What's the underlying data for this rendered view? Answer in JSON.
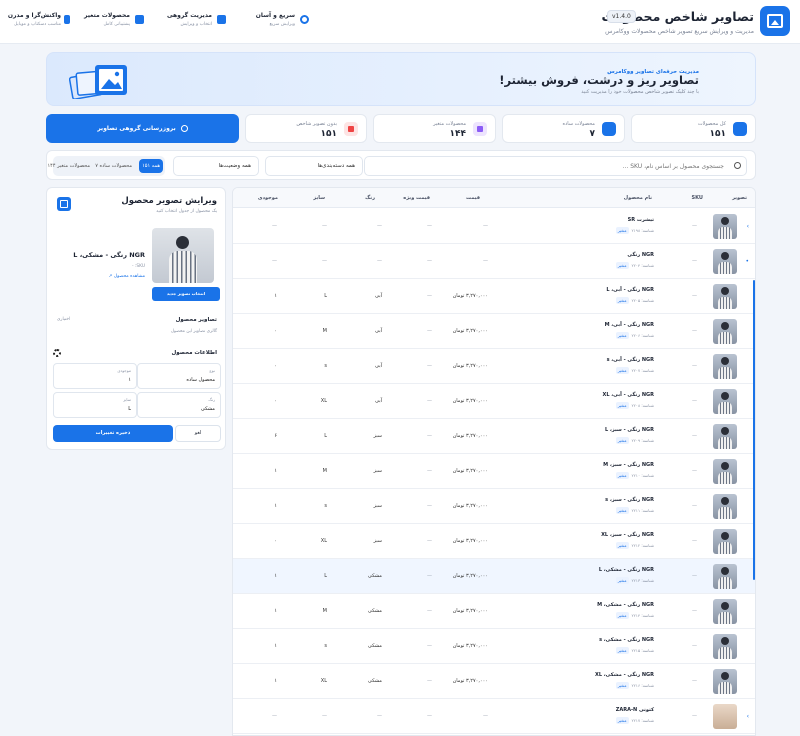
{
  "header": {
    "title": "تصاویر شاخص محصولات",
    "version": "v1.4.0",
    "subtitle": "مدیریت و ویرایش سریع تصویر شاخص محصولات ووکامرس",
    "nav": [
      {
        "title": "سریع و آسان",
        "sub": "ویرایش سریع"
      },
      {
        "title": "مدیریت گروهی",
        "sub": "انتخاب و ویرایش"
      },
      {
        "title": "محصولات متغیر",
        "sub": "پشتیبانی کامل"
      },
      {
        "title": "واکنش‌گرا و مدرن",
        "sub": "مناسب دسکتاپ و موبایل"
      }
    ]
  },
  "hero": {
    "kicker": "مدیریت حرفه‌ای تصاویر ووکامرس",
    "title": "تصاویر ریز و درشت، فروش بیشتر!",
    "subtitle": "با چند کلیک تصویر شاخص محصولات خود را مدیریت کنید"
  },
  "stats": [
    {
      "label": "کل محصولات",
      "value": "۱۵۱",
      "color": "#1a73e8"
    },
    {
      "label": "محصولات ساده",
      "value": "۷",
      "color": "#1a73e8"
    },
    {
      "label": "محصولات متغیر",
      "value": "۱۴۴",
      "color": "#8b5cf6"
    },
    {
      "label": "بدون تصویر شاخص",
      "value": "۱۵۱",
      "color": "#ef4444"
    }
  ],
  "bulk_label": "بروزرسانی گروهی تصاویر",
  "filters": {
    "search_placeholder": "جستجوی محصول بر اساس نام، SKU ...",
    "category": "همه دسته‌بندی‌ها",
    "status": "همه وضعیت‌ها",
    "seg_all": "همه ۱۵۱",
    "seg_simple": "محصولات ساده ۷",
    "seg_variable": "محصولات متغیر ۱۴۴"
  },
  "table": {
    "headers": {
      "image": "تصویر",
      "sku": "SKU",
      "name": "نام محصول",
      "price": "قیمت",
      "sale": "قیمت ویژه",
      "color": "رنگ",
      "size": "سایز",
      "stock": "موجودی"
    },
    "rows": [
      {
        "name": "تیشرت SR",
        "meta": "شناسه: ۲۱۹۸",
        "tag": "متغیر",
        "sku": "—",
        "price": "—",
        "sale": "—",
        "color": "—",
        "size": "—",
        "stock": "—",
        "expand": "›"
      },
      {
        "name": "NGR رنگی",
        "meta": "شناسه: ۲۲۰۴",
        "tag": "متغیر",
        "sku": "—",
        "price": "—",
        "sale": "—",
        "color": "—",
        "size": "—",
        "stock": "—",
        "expand": "•"
      },
      {
        "name": "NGR رنگی - آبی، L",
        "meta": "شناسه: ۲۲۰۵",
        "tag": "متغیر",
        "sku": "—",
        "price": "۳,۲۷۰,۰۰۰ تومان",
        "sale": "—",
        "color": "آبی",
        "size": "L",
        "stock": "۱"
      },
      {
        "name": "NGR رنگی - آبی، M",
        "meta": "شناسه: ۲۲۰۶",
        "tag": "متغیر",
        "sku": "—",
        "price": "۳,۲۷۰,۰۰۰ تومان",
        "sale": "—",
        "color": "آبی",
        "size": "M",
        "stock": "۰"
      },
      {
        "name": "NGR رنگی - آبی، s",
        "meta": "شناسه: ۲۲۰۷",
        "tag": "متغیر",
        "sku": "—",
        "price": "۳,۲۷۰,۰۰۰ تومان",
        "sale": "—",
        "color": "آبی",
        "size": "s",
        "stock": "۰"
      },
      {
        "name": "NGR رنگی - آبی، XL",
        "meta": "شناسه: ۲۲۰۸",
        "tag": "متغیر",
        "sku": "—",
        "price": "۳,۲۷۰,۰۰۰ تومان",
        "sale": "—",
        "color": "آبی",
        "size": "XL",
        "stock": "۰"
      },
      {
        "name": "NGR رنگی - سبز، L",
        "meta": "شناسه: ۲۲۰۹",
        "tag": "متغیر",
        "sku": "—",
        "price": "۳,۲۷۰,۰۰۰ تومان",
        "sale": "—",
        "color": "سبز",
        "size": "L",
        "stock": "۶"
      },
      {
        "name": "NGR رنگی - سبز، M",
        "meta": "شناسه: ۲۲۱۰",
        "tag": "متغیر",
        "sku": "—",
        "price": "۳,۲۷۰,۰۰۰ تومان",
        "sale": "—",
        "color": "سبز",
        "size": "M",
        "stock": "۱"
      },
      {
        "name": "NGR رنگی - سبز، s",
        "meta": "شناسه: ۲۲۱۱",
        "tag": "متغیر",
        "sku": "—",
        "price": "۳,۲۷۰,۰۰۰ تومان",
        "sale": "—",
        "color": "سبز",
        "size": "s",
        "stock": "۱"
      },
      {
        "name": "NGR رنگی - سبز، XL",
        "meta": "شناسه: ۲۲۱۲",
        "tag": "متغیر",
        "sku": "—",
        "price": "۳,۲۷۰,۰۰۰ تومان",
        "sale": "—",
        "color": "سبز",
        "size": "XL",
        "stock": "۰"
      },
      {
        "name": "NGR رنگی - مشکی، L",
        "meta": "شناسه: ۲۲۱۳",
        "tag": "متغیر",
        "sku": "—",
        "price": "۳,۲۷۰,۰۰۰ تومان",
        "sale": "—",
        "color": "مشکی",
        "size": "L",
        "stock": "۱",
        "hl": true
      },
      {
        "name": "NGR رنگی - مشکی، M",
        "meta": "شناسه: ۲۲۱۴",
        "tag": "متغیر",
        "sku": "—",
        "price": "۳,۲۷۰,۰۰۰ تومان",
        "sale": "—",
        "color": "مشکی",
        "size": "M",
        "stock": "۱"
      },
      {
        "name": "NGR رنگی - مشکی، s",
        "meta": "شناسه: ۲۲۱۵",
        "tag": "متغیر",
        "sku": "—",
        "price": "۳,۲۷۰,۰۰۰ تومان",
        "sale": "—",
        "color": "مشکی",
        "size": "s",
        "stock": "۱"
      },
      {
        "name": "NGR رنگی - مشکی، XL",
        "meta": "شناسه: ۲۲۱۶",
        "tag": "متغیر",
        "sku": "—",
        "price": "۳,۲۷۰,۰۰۰ تومان",
        "sale": "—",
        "color": "مشکی",
        "size": "XL",
        "stock": "۱"
      },
      {
        "name": "کتونی ZARA-N",
        "meta": "شناسه: ۲۲۱۷",
        "tag": "متغیر",
        "sku": "—",
        "price": "—",
        "sale": "—",
        "color": "—",
        "size": "—",
        "stock": "—",
        "expand": "›",
        "shoe": true
      }
    ]
  },
  "editor": {
    "title": "ویرایش تصویر محصول",
    "subtitle": "یک محصول از جدول انتخاب کنید",
    "product_name": "NGR رنگی - مشکی، L",
    "sku": "SKU: -",
    "view_link": "مشاهده محصول ↗",
    "pick_button": "انتخاب تصویر جدید",
    "gallery_title": "تصاویر محصول",
    "optional": "اختیاری",
    "gallery_note": "گالری تصاویر این محصول",
    "info_title": "اطلاعات محصول",
    "fields": [
      {
        "label": "نوع",
        "value": "محصول ساده"
      },
      {
        "label": "موجودی",
        "value": "۱"
      },
      {
        "label": "رنگ",
        "value": "مشکی"
      },
      {
        "label": "سایز",
        "value": "L"
      }
    ],
    "save": "ذخیره تغییرات",
    "cancel": "لغو"
  }
}
